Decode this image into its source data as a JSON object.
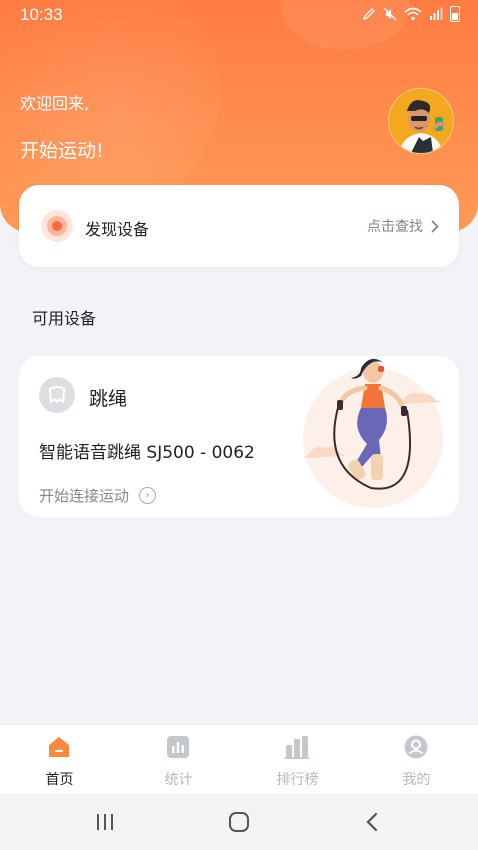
{
  "status_bar": {
    "time": "10:33"
  },
  "header": {
    "welcome": "欢迎回来,",
    "start": "开始运动!"
  },
  "discover": {
    "title": "发现设备",
    "link": "点击查找"
  },
  "available": {
    "title": "可用设备"
  },
  "device": {
    "name": "跳绳",
    "model": "智能语音跳绳 SJ500 - 0062",
    "connect": "开始连接运动"
  },
  "tabs": [
    {
      "label": "首页",
      "icon": "home-icon",
      "active": true
    },
    {
      "label": "统计",
      "icon": "stats-icon",
      "active": false
    },
    {
      "label": "排行榜",
      "icon": "ranking-icon",
      "active": false
    },
    {
      "label": "我的",
      "icon": "profile-icon",
      "active": false
    }
  ],
  "colors": {
    "accent": "#ff7b41",
    "tab_active": "#ff8a3d",
    "tab_inactive": "#c4c7cc"
  }
}
